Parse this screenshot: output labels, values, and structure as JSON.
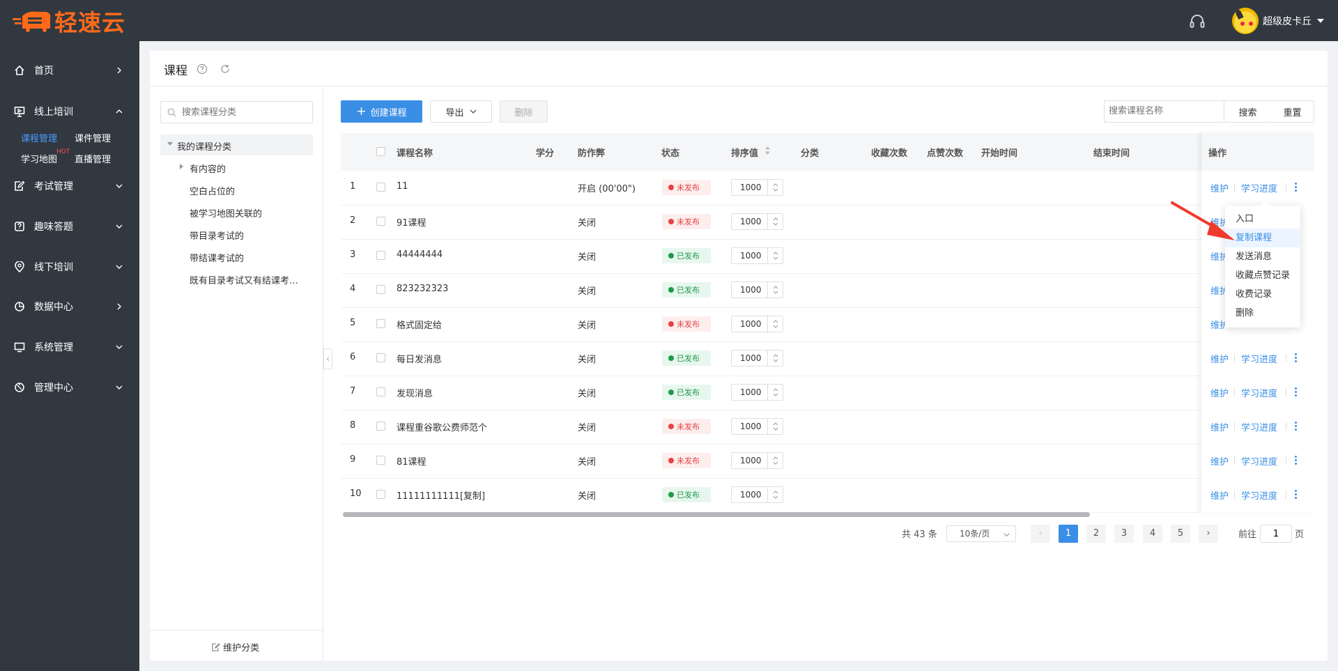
{
  "header": {
    "logo_text": "轻速云",
    "username": "超级皮卡丘",
    "colors": {
      "bar": "#313840",
      "brand": "#ff6a1a"
    }
  },
  "sidebar": {
    "home": "首页",
    "online_training": "线上培训",
    "sub": {
      "course_manage": "课程管理",
      "courseware_manage": "课件管理",
      "learning_map": "学习地图",
      "hot": "HOT",
      "live_manage": "直播管理"
    },
    "exam_manage": "考试管理",
    "fun_quiz": "趣味答题",
    "offline_training": "线下培训",
    "data_center": "数据中心",
    "system_manage": "系统管理",
    "admin_center": "管理中心"
  },
  "page": {
    "title": "课程"
  },
  "tree": {
    "search_placeholder": "搜索课程分类",
    "root": "我的课程分类",
    "nodes": [
      "有内容的",
      "空白占位的",
      "被学习地图关联的",
      "带目录考试的",
      "带结课考试的",
      "既有目录考试又有结课考…"
    ],
    "footer": "维护分类"
  },
  "toolbar": {
    "create": "创建课程",
    "export": "导出",
    "delete": "删除",
    "search_placeholder": "搜索课程名称",
    "search": "搜索",
    "reset": "重置"
  },
  "table": {
    "headers": {
      "name": "课程名称",
      "credit": "学分",
      "anti_cheat": "防作弊",
      "status": "状态",
      "sort": "排序值",
      "category": "分类",
      "fav_count": "收藏次数",
      "like_count": "点赞次数",
      "start_time": "开始时间",
      "end_time": "结束时间",
      "ops": "操作"
    },
    "rows": [
      {
        "no": "1",
        "name": "11",
        "anti": "开启 (00'00\")",
        "status": "未发布",
        "published": false,
        "sort": "1000"
      },
      {
        "no": "2",
        "name": "91课程",
        "anti": "关闭",
        "status": "未发布",
        "published": false,
        "sort": "1000"
      },
      {
        "no": "3",
        "name": "44444444",
        "anti": "关闭",
        "status": "已发布",
        "published": true,
        "sort": "1000"
      },
      {
        "no": "4",
        "name": "823232323",
        "anti": "关闭",
        "status": "已发布",
        "published": true,
        "sort": "1000"
      },
      {
        "no": "5",
        "name": "格式固定给",
        "anti": "关闭",
        "status": "未发布",
        "published": false,
        "sort": "1000"
      },
      {
        "no": "6",
        "name": "每日发消息",
        "anti": "关闭",
        "status": "已发布",
        "published": true,
        "sort": "1000"
      },
      {
        "no": "7",
        "name": "发现消息",
        "anti": "关闭",
        "status": "已发布",
        "published": true,
        "sort": "1000"
      },
      {
        "no": "8",
        "name": "课程重谷歌公费师范个",
        "anti": "关闭",
        "status": "未发布",
        "published": false,
        "sort": "1000"
      },
      {
        "no": "9",
        "name": "81课程",
        "anti": "关闭",
        "status": "未发布",
        "published": false,
        "sort": "1000"
      },
      {
        "no": "10",
        "name": "11111111111[复制]",
        "anti": "关闭",
        "status": "已发布",
        "published": true,
        "sort": "1000"
      }
    ],
    "op_maintain": "维护",
    "op_progress": "学习进度",
    "op_maintain_clipped": "维护"
  },
  "dropdown": {
    "items": [
      "入口",
      "复制课程",
      "发送消息",
      "收藏点赞记录",
      "收费记录",
      "删除"
    ],
    "hovered_item": "复制课程"
  },
  "pagination": {
    "total": "共 43 条",
    "page_size": "10条/页",
    "pages": [
      "1",
      "2",
      "3",
      "4",
      "5"
    ],
    "current": "1",
    "goto": "前往",
    "goto_value": "1",
    "page_suffix": "页"
  }
}
